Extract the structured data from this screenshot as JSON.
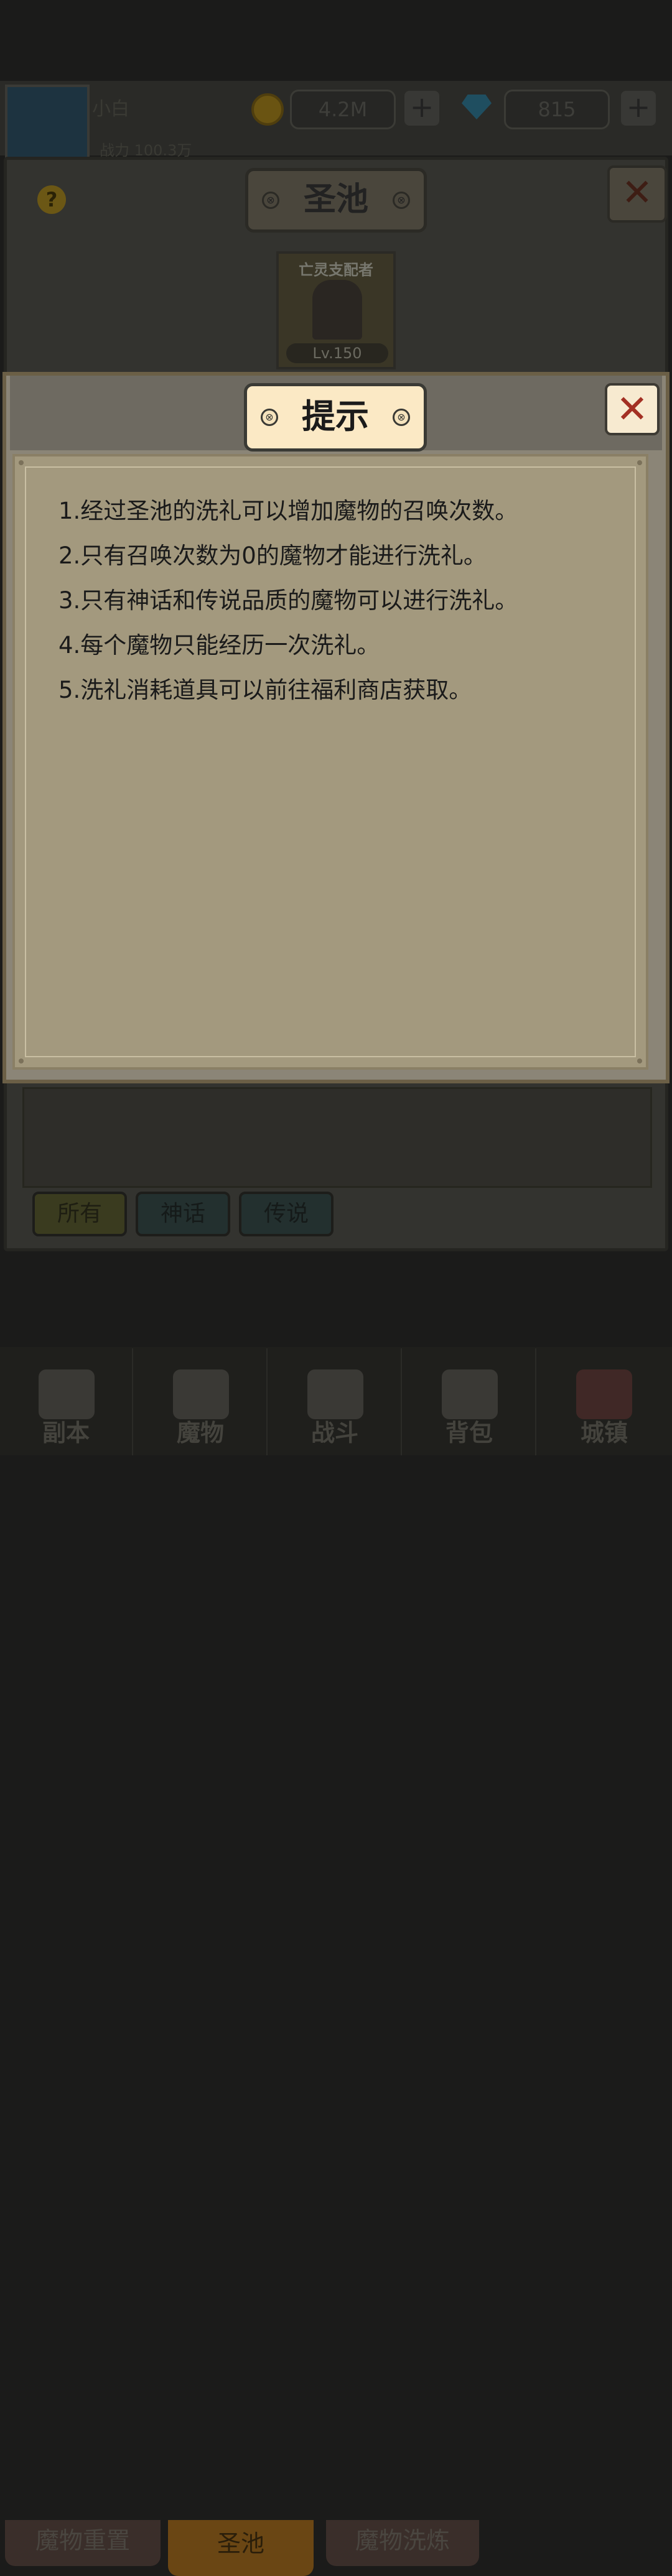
{
  "header": {
    "player_name": "小白",
    "level_text": "战力 100.3万",
    "coins": "4.2M",
    "gems": "815",
    "plus_label": "+"
  },
  "shrine": {
    "title": "圣池",
    "help_label": "?",
    "close_label": "✕",
    "monster": {
      "name": "亡灵支配者",
      "level": "Lv.150"
    },
    "filters": [
      "所有",
      "神话",
      "传说"
    ]
  },
  "tabs": [
    "魔物重置",
    "圣池",
    "魔物洗炼"
  ],
  "bottom_nav": [
    "副本",
    "魔物",
    "战斗",
    "背包",
    "城镇"
  ],
  "modal": {
    "title": "提示",
    "close_label": "✕",
    "tips": [
      "1.经过圣池的洗礼可以增加魔物的召唤次数。",
      "2.只有召唤次数为0的魔物才能进行洗礼。",
      "3.只有神话和传说品质的魔物可以进行洗礼。",
      "4.每个魔物只能经历一次洗礼。",
      "5.洗礼消耗道具可以前往福利商店获取。"
    ]
  },
  "colors": {
    "overlay_dim": "#1b1b1a",
    "modal_bg": "#8b8577",
    "content_bg": "#a3997e",
    "title_plate": "#fbe9c5",
    "close_x": "#a33023"
  }
}
